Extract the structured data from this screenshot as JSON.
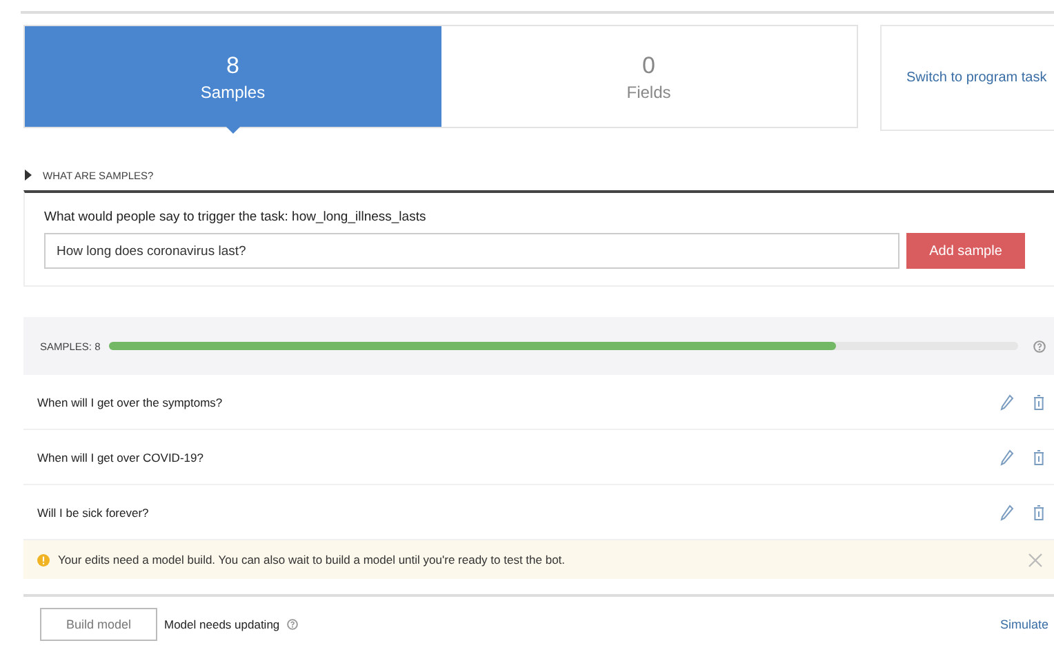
{
  "tabs": [
    {
      "count": "8",
      "label": "Samples",
      "selected": true
    },
    {
      "count": "0",
      "label": "Fields",
      "selected": false
    }
  ],
  "switch_link": "Switch to program task",
  "help_toggle": {
    "label": "WHAT ARE SAMPLES?",
    "expanded": false
  },
  "sample_form": {
    "prompt": "What would people say to trigger the task: how_long_illness_lasts",
    "value": "How long does coronavirus last?",
    "button": "Add sample"
  },
  "samples_bar": {
    "label": "SAMPLES: 8",
    "level": 0.8
  },
  "samples": [
    "When will I get over the symptoms?",
    "When will I get over COVID-19?",
    "Will I be sick forever?"
  ],
  "notice": "Your edits need a model build. You can also wait to build a model until you're ready to test the bot.",
  "footer": {
    "build_button": "Build model",
    "status": "Model needs updating",
    "simulate": "Simulate"
  }
}
